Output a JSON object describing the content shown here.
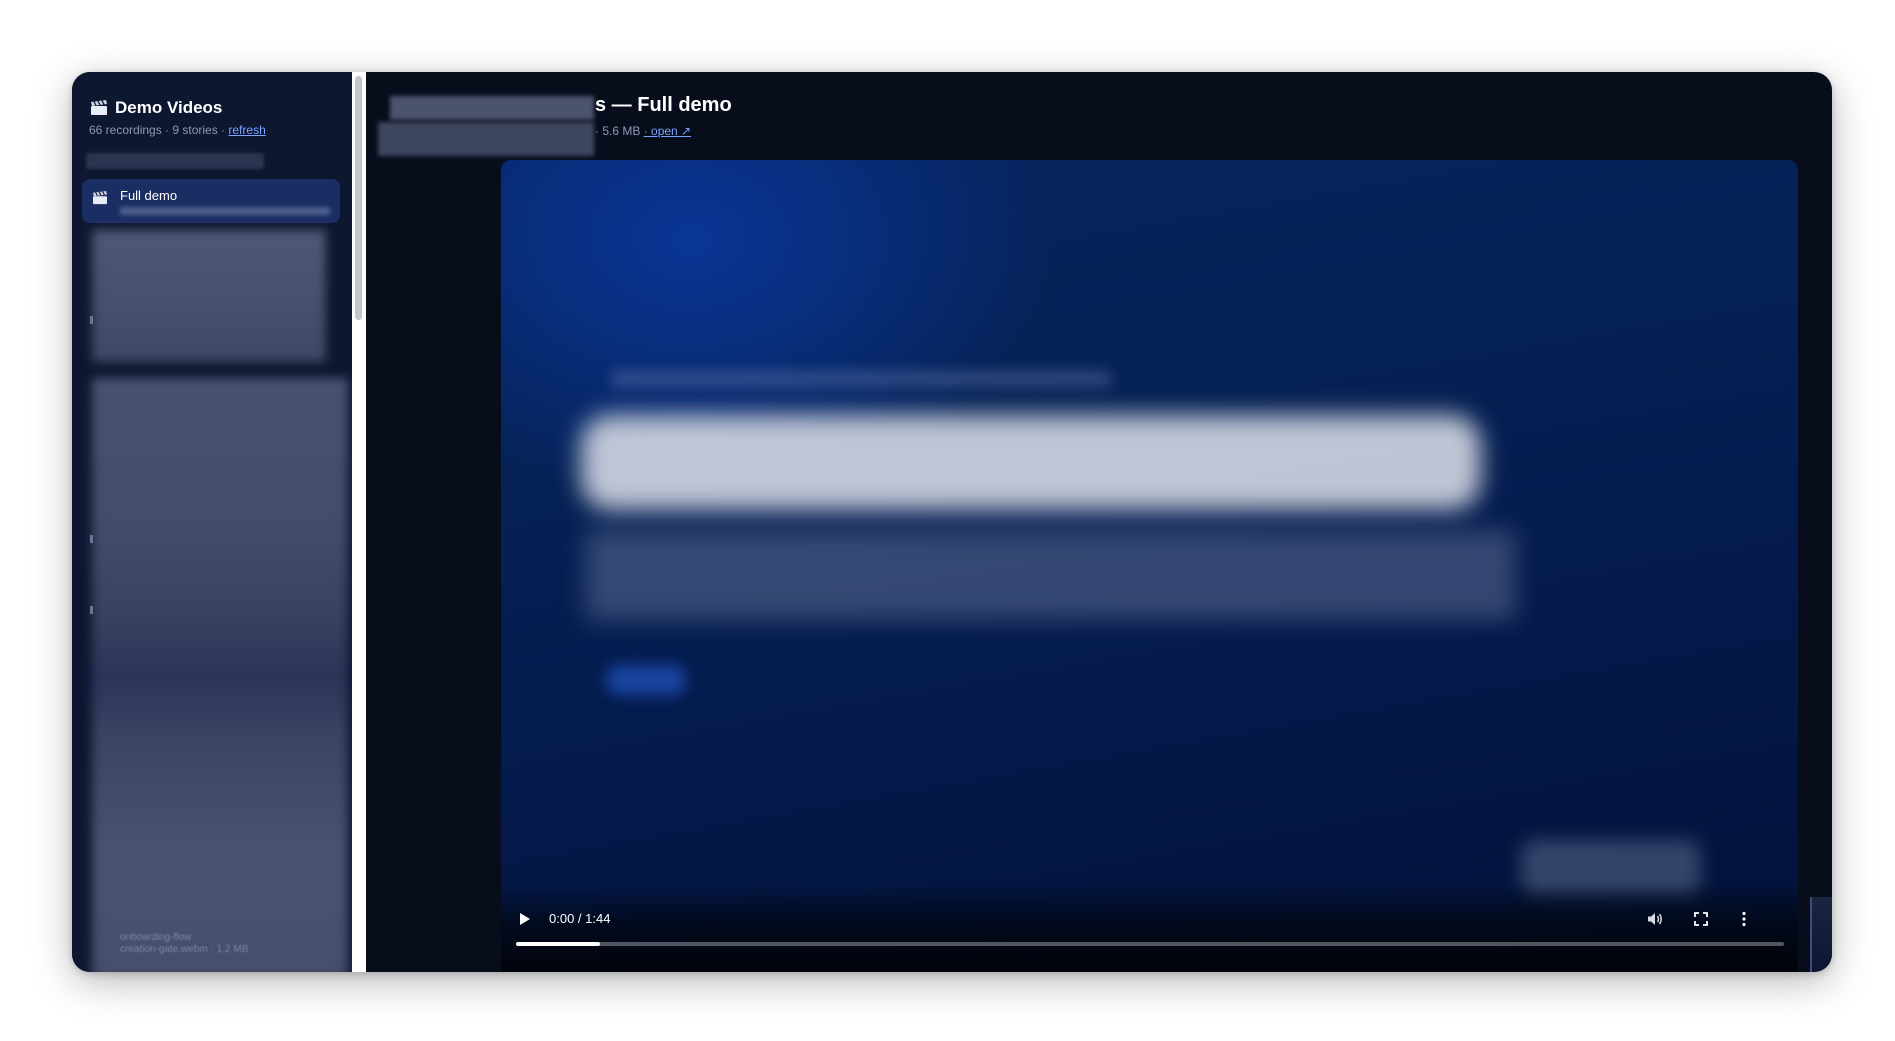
{
  "sidebar": {
    "title": "Demo Videos",
    "meta_counts": "66 recordings · 9 stories · ",
    "refresh_label": "refresh",
    "active_item": {
      "label": "Full demo",
      "icon": "clapperboard-icon"
    },
    "last_item": {
      "label": "onboarding-flow",
      "sub": "creation-gate.webm · 1.2 MB"
    }
  },
  "main": {
    "title": "s — Full demo",
    "meta_size": "· 5.6 MB ",
    "open_label": "· open ↗"
  },
  "player": {
    "time_display": "0:00 / 1:44",
    "progress_fraction": 0.066,
    "icons": [
      "play-icon",
      "volume-icon",
      "fullscreen-icon",
      "more-options-icon"
    ]
  },
  "colors": {
    "sidebar_bg": "#0d1730",
    "active_item_bg": "#1b2e63",
    "link": "#7aa2ff",
    "window_bg": "#080d1c"
  }
}
